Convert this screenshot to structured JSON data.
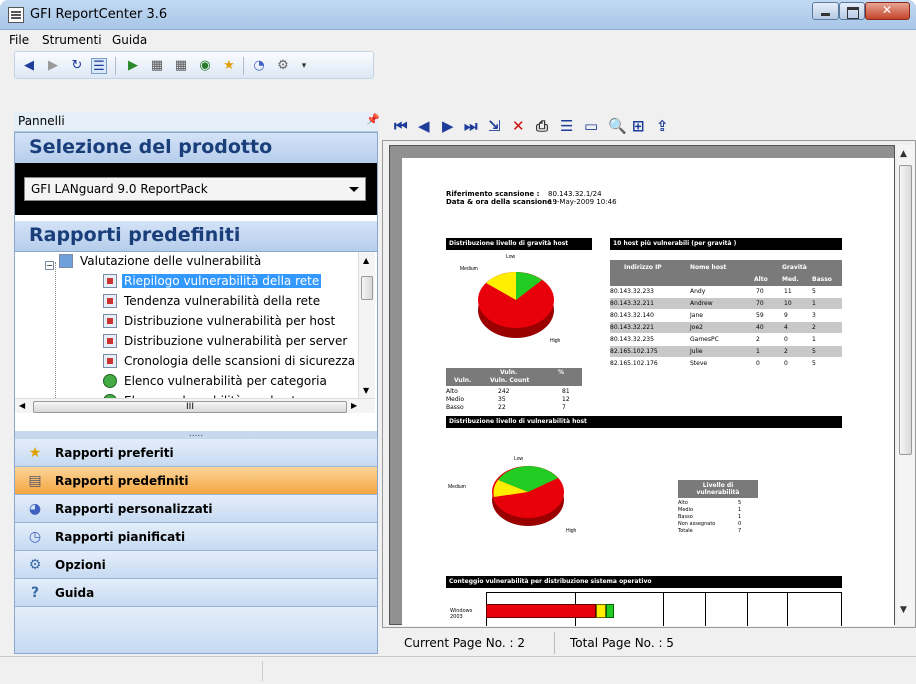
{
  "window": {
    "title": "GFI ReportCenter 3.6"
  },
  "menu": [
    "File",
    "Strumenti",
    "Guida"
  ],
  "panel": {
    "header": "Pannelli",
    "pin": "ᵖ"
  },
  "product": {
    "title": "Selezione del prodotto",
    "selected": "GFI LANguard 9.0 ReportPack"
  },
  "reports": {
    "title": "Rapporti predefiniti",
    "folder": "Valutazione delle vulnerabilità",
    "items": [
      "Riepilogo vulnerabilità della rete",
      "Tendenza vulnerabilità della rete",
      "Distribuzione vulnerabilità per host",
      "Distribuzione vulnerabilità per server",
      "Cronologia delle scansioni di sicurezza",
      "Elenco vulnerabilità per categoria",
      "Elenco vulnerabilità per host"
    ]
  },
  "hscroll_label": "III",
  "splitter_label": ".....",
  "nav": [
    {
      "label": "Rapporti preferiti",
      "icon": "star-icon"
    },
    {
      "label": "Rapporti predefiniti",
      "icon": "report-icon"
    },
    {
      "label": "Rapporti personalizzati",
      "icon": "custom-report-icon"
    },
    {
      "label": "Rapporti pianificati",
      "icon": "clock-icon"
    },
    {
      "label": "Opzioni",
      "icon": "options-icon"
    },
    {
      "label": "Guida",
      "icon": "help-icon"
    }
  ],
  "viewer": {
    "current_page": "Current Page No. : 2",
    "total_page": "Total Page No. : 5"
  },
  "report": {
    "scan_ref_label": "Riferimento scansione :",
    "scan_ref_value": "80.143.32.1/24",
    "scan_date_label": "Data & ora della scansione :",
    "scan_date_value": "19-May-2009 10:46",
    "pie1_title": "Distribuzione livello di gravità host",
    "pie1_labels": [
      "Low",
      "Medium",
      "High"
    ],
    "hosts_title": "10 host più vulnerabili (per gravità )",
    "hosts_headers": [
      "Indirizzo IP",
      "Nome host",
      "Gravità",
      "Alto",
      "Med.",
      "Basso"
    ],
    "hosts_rows": [
      [
        "80.143.32.233",
        "Andy",
        "70",
        "11",
        "5"
      ],
      [
        "80.143.32.211",
        "Andrew",
        "70",
        "10",
        "1"
      ],
      [
        "80.143.32.140",
        "Jane",
        "59",
        "9",
        "3"
      ],
      [
        "80.143.32.221",
        "Joe2",
        "40",
        "4",
        "2"
      ],
      [
        "80.143.32.235",
        "GamesPC",
        "2",
        "0",
        "1"
      ],
      [
        "82.165.102.175",
        "Julie",
        "1",
        "2",
        "5"
      ],
      [
        "82.165.102.176",
        "Steve",
        "0",
        "0",
        "5"
      ]
    ],
    "vuln_headers": [
      "Vuln.",
      "Vuln. Count",
      "%"
    ],
    "vuln_rows": [
      [
        "Alto",
        "242",
        "81"
      ],
      [
        "Medio",
        "35",
        "12"
      ],
      [
        "Basso",
        "22",
        "7"
      ]
    ],
    "pie2_title": "Distribuzione livello di vulnerabilità host",
    "pie2_labels": [
      "Low",
      "Medium",
      "High"
    ],
    "level_header": "Livello di vulnerabilità",
    "level_rows": [
      [
        "Alto",
        "5"
      ],
      [
        "Medio",
        "1"
      ],
      [
        "Basso",
        "1"
      ],
      [
        "Non assegnato",
        "0"
      ],
      [
        "Totale",
        "7"
      ]
    ],
    "os_title": "Conteggio vulnerabilità per distribuzione sistema operativo",
    "os_label": "Windows 2003"
  },
  "colors": {
    "high": "#e8000b",
    "medium": "#ffee00",
    "low": "#22cc22",
    "accent": "#f4a540"
  }
}
